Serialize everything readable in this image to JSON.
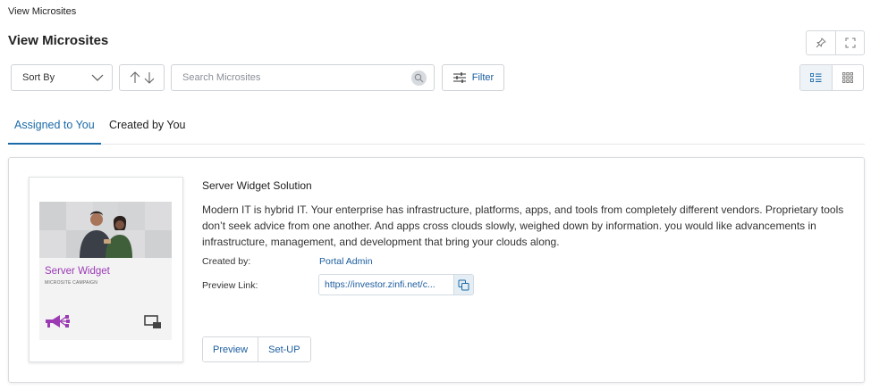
{
  "breadcrumb": "View Microsites",
  "page_title": "View Microsites",
  "toolbar": {
    "sort_label": "Sort By",
    "search_placeholder": "Search Microsites",
    "filter_label": "Filter"
  },
  "tabs": [
    {
      "label": "Assigned to You",
      "active": true
    },
    {
      "label": "Created by You",
      "active": false
    }
  ],
  "card": {
    "title": "Server Widget Solution",
    "description": "Modern IT is hybrid IT. Your enterprise has infrastructure, platforms, apps, and tools from completely different vendors. Proprietary tools don’t seek advice from one another. And apps cross clouds slowly, weighed down by information. you would like advancements in infrastructure, management, and development that bring your clouds along.",
    "created_by_label": "Created by:",
    "created_by_value": "Portal Admin",
    "preview_link_label": "Preview Link:",
    "preview_link_value": "https://investor.zinfi.net/c...",
    "thumbnail_title": "Server Widget",
    "thumbnail_subtitle": "MICROSITE CAMPAIGN",
    "preview_button": "Preview",
    "setup_button": "Set-UP"
  },
  "icons": {
    "top_actions": [
      "pin-icon",
      "fullscreen-icon"
    ],
    "view_toggle": [
      "list-view-icon",
      "grid-view-icon"
    ]
  },
  "colors": {
    "accent": "#1a6aa8",
    "link": "#1a5c9e",
    "thumbnail_brand": "#9b3ab3"
  }
}
